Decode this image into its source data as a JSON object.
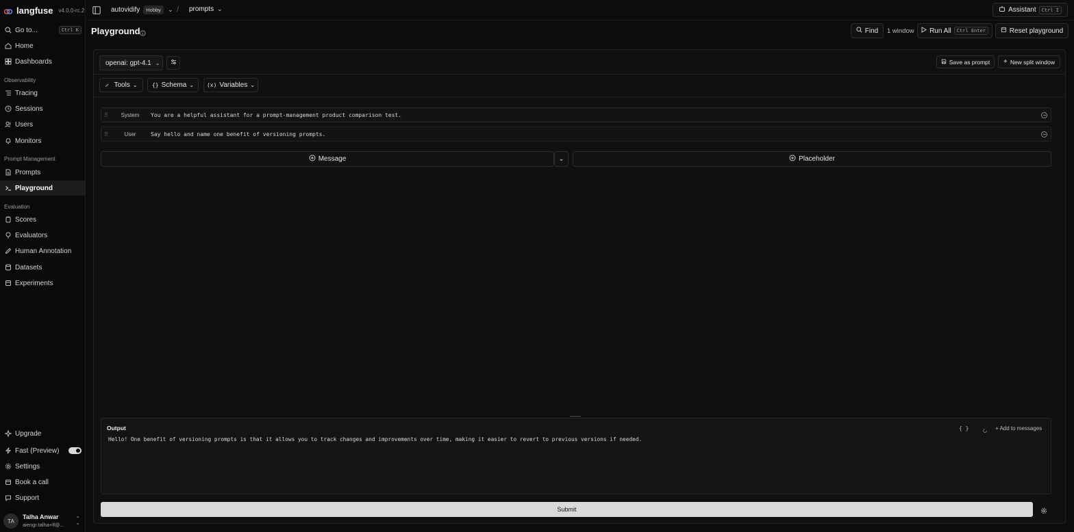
{
  "app": {
    "logo_text": "langfuse",
    "version": "v4.0.0-rc.2"
  },
  "sidebar": {
    "goto_label": "Go to...",
    "goto_shortcut": "Ctrl K",
    "items_top": [
      {
        "label": "Home",
        "icon": "home-icon"
      },
      {
        "label": "Dashboards",
        "icon": "dashboard-icon"
      }
    ],
    "sections": [
      {
        "title": "Observability",
        "items": [
          "Tracing",
          "Sessions",
          "Users",
          "Monitors"
        ]
      },
      {
        "title": "Prompt Management",
        "items": [
          "Prompts",
          "Playground"
        ]
      },
      {
        "title": "Evaluation",
        "items": [
          "Scores",
          "Evaluators",
          "Human Annotation",
          "Datasets",
          "Experiments"
        ]
      }
    ],
    "active_item": "Playground",
    "bottom_items": {
      "upgrade": "Upgrade",
      "fast_preview": "Fast (Preview)",
      "settings": "Settings",
      "book_call": "Book a call",
      "support": "Support"
    },
    "fast_preview_enabled": true,
    "user": {
      "initials": "TA",
      "name": "Talha Anwar",
      "email": "aiengr.talha+lf@..."
    }
  },
  "topbar": {
    "org": "autovidify",
    "plan_badge": "Hobby",
    "project": "prompts",
    "assistant_label": "Assistant",
    "assistant_shortcut": "Ctrl I"
  },
  "header": {
    "title": "Playground",
    "find_label": "Find",
    "window_count": "1 window",
    "run_all_label": "Run All",
    "run_all_shortcut": "Ctrl Enter",
    "reset_label": "Reset playground"
  },
  "panel": {
    "model_label": "openai: gpt-4.1",
    "save_as_prompt": "Save as prompt",
    "new_split_window": "New split window",
    "tools_label": "Tools",
    "schema_label": "Schema",
    "variables_label": "Variables",
    "messages": [
      {
        "role": "System",
        "text": "You are a helpful assistant for a prompt-management product comparison test."
      },
      {
        "role": "User",
        "text": "Say hello and name one benefit of versioning prompts."
      }
    ],
    "add_message_label": "Message",
    "add_placeholder_label": "Placeholder",
    "output": {
      "title": "Output",
      "json_toggle": "{ }",
      "add_to_messages": "+ Add to messages",
      "text": "Hello! One benefit of versioning prompts is that it allows you to track changes and improvements over time, making it easier to revert to previous versions if needed."
    },
    "submit_label": "Submit"
  }
}
